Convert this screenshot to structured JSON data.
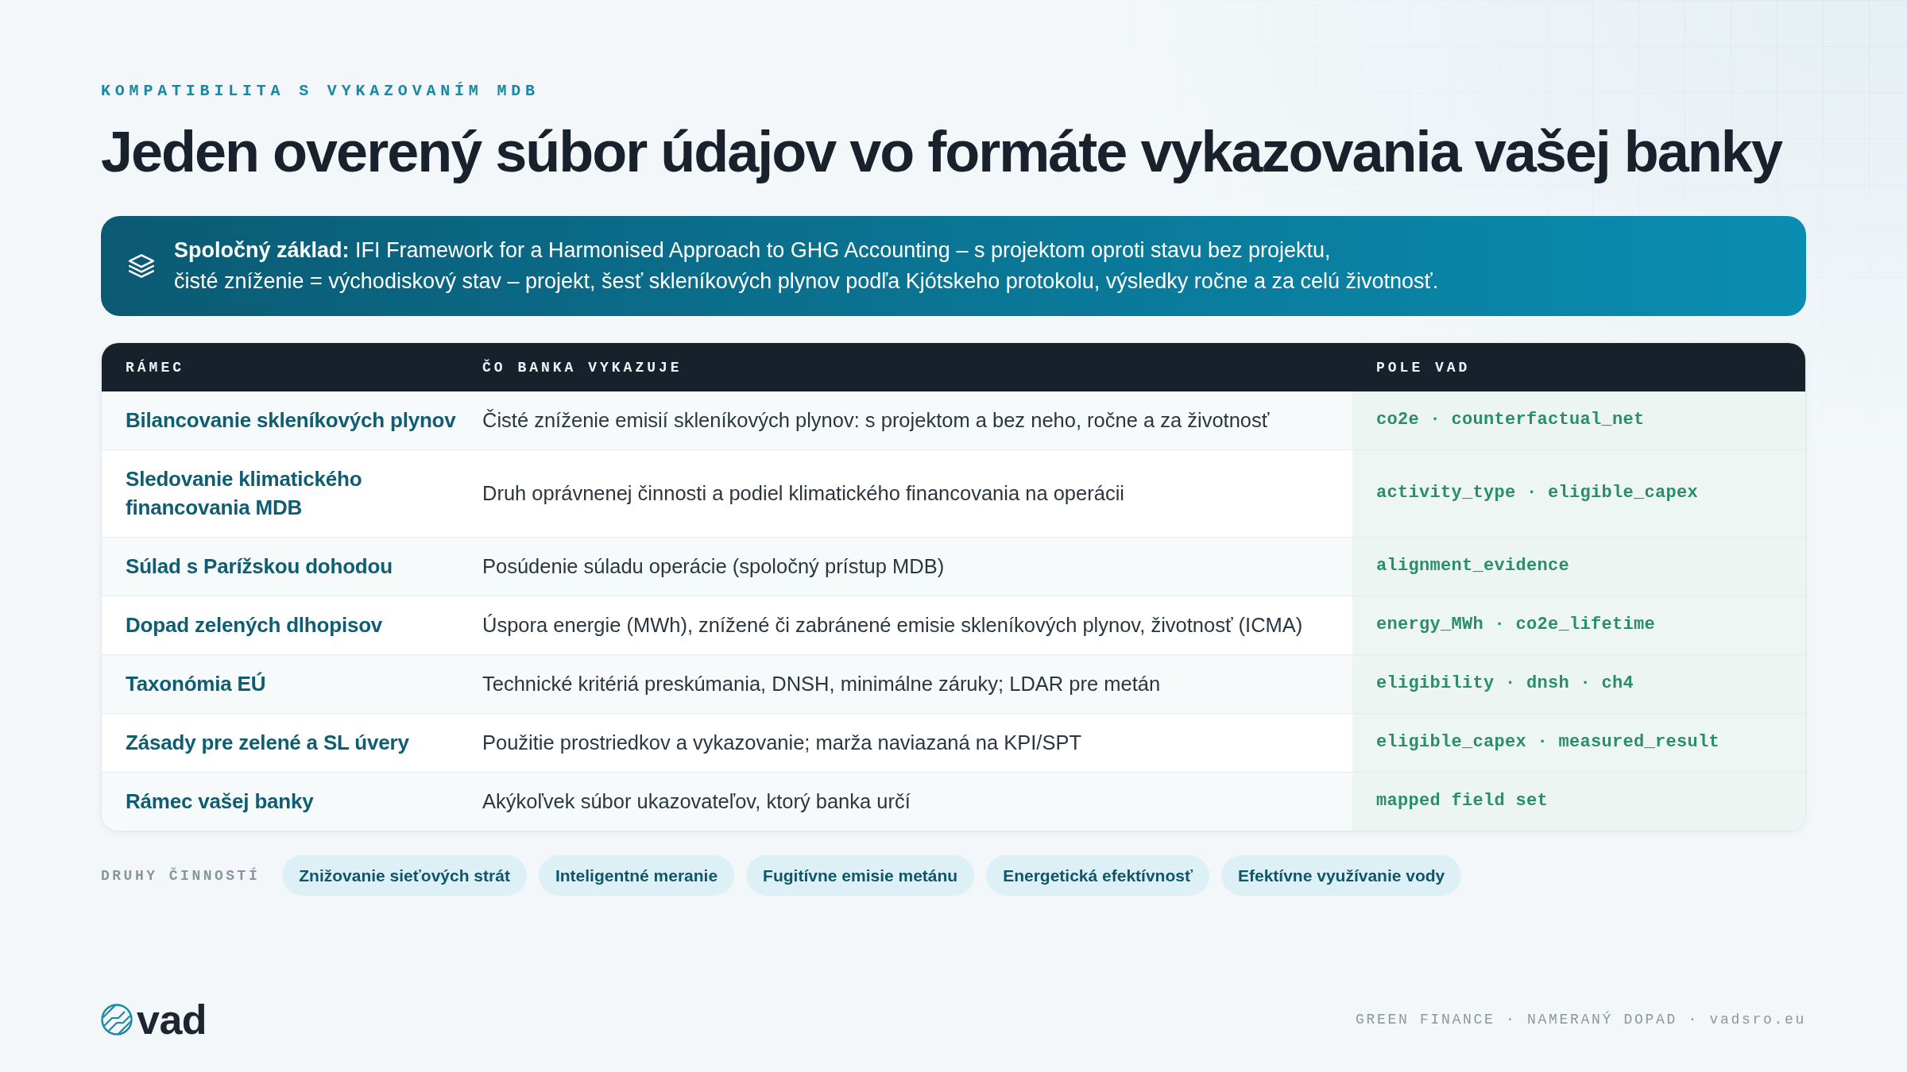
{
  "header": {
    "eyebrow": "KOMPATIBILITA S VYKAZOVANÍM MDB",
    "title": "Jeden overený súbor údajov vo formáte vykazovania vašej banky"
  },
  "banner": {
    "lines": [
      "**Spoločný základ:** IFI Framework for a Harmonised Approach to GHG Accounting – s projektom oproti stavu bez projektu,",
      "čisté zníženie = východiskový stav – projekt, šesť skleníkových plynov podľa Kjótskeho protokolu, výsledky ročne a za celú životnosť."
    ]
  },
  "table": {
    "columns": [
      "RÁMEC",
      "ČO BANKA VYKAZUJE",
      "POLE VAD"
    ],
    "rows": [
      {
        "framework": "Bilancovanie skleníkových plynov",
        "reported": "Čisté zníženie emisií skleníkových plynov: s projektom a bez neho, ročne a za životnosť",
        "vad_fields": "co2e · counterfactual_net"
      },
      {
        "framework": "Sledovanie klimatického financovania MDB",
        "reported": "Druh oprávnenej činnosti a podiel klimatického financovania na operácii",
        "vad_fields": "activity_type · eligible_capex"
      },
      {
        "framework": "Súlad s Parížskou dohodou",
        "reported": "Posúdenie súladu operácie (spoločný prístup MDB)",
        "vad_fields": "alignment_evidence"
      },
      {
        "framework": "Dopad zelených dlhopisov",
        "reported": "Úspora energie (MWh), znížené či zabránené emisie skleníkových plynov, životnosť (ICMA)",
        "vad_fields": "energy_MWh · co2e_lifetime"
      },
      {
        "framework": "Taxonómia EÚ",
        "reported": "Technické kritériá preskúmania, DNSH, minimálne záruky; LDAR pre metán",
        "vad_fields": "eligibility · dnsh · ch4"
      },
      {
        "framework": "Zásady pre zelené a SL úvery",
        "reported": "Použitie prostriedkov a vykazovanie; marža naviazaná na KPI/SPT",
        "vad_fields": "eligible_capex · measured_result"
      },
      {
        "framework": "Rámec vašej banky",
        "reported": "Akýkoľvek súbor ukazovateľov, ktorý banka určí",
        "vad_fields": "mapped field set"
      }
    ]
  },
  "activities": {
    "label": "DRUHY ČINNOSTÍ",
    "chips": [
      "Znižovanie sieťových strát",
      "Inteligentné meranie",
      "Fugitívne emisie metánu",
      "Energetická efektívnosť",
      "Efektívne využívanie vody"
    ]
  },
  "footer": {
    "brand": "vad",
    "tagline": "GREEN FINANCE · NAMERANÝ DOPAD · vadsro.eu"
  }
}
